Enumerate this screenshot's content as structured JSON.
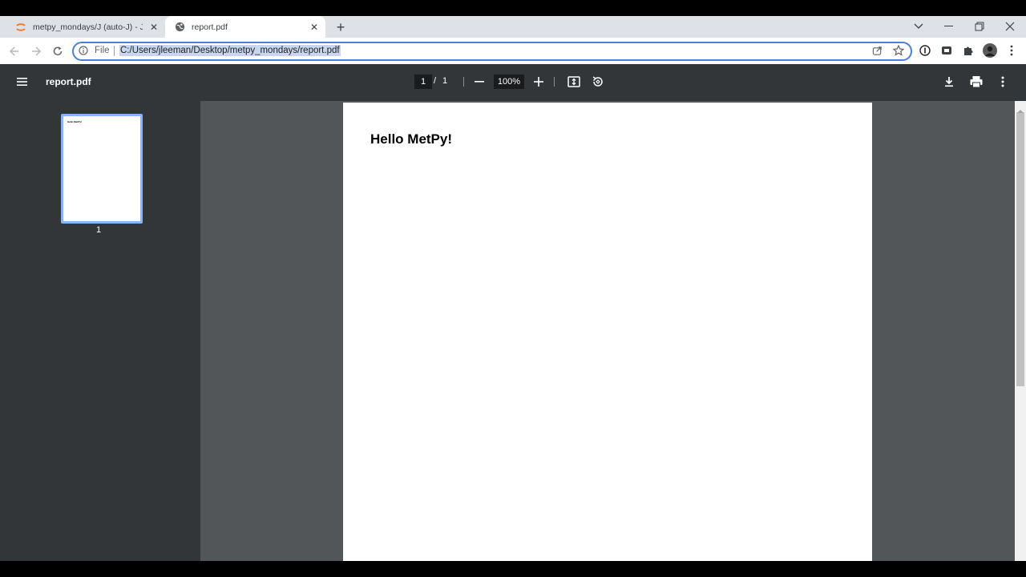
{
  "browser": {
    "tabs": [
      {
        "title": "metpy_mondays/J (auto-J) - Jupy",
        "active": false,
        "favicon": "jupyter-icon"
      },
      {
        "title": "report.pdf",
        "active": true,
        "favicon": "globe-icon"
      }
    ],
    "new_tab_label": "+",
    "address": {
      "scheme_label": "File",
      "url": "C:/Users/jleeman/Desktop/metpy_mondays/report.pdf"
    },
    "colors": {
      "accent": "#4a7fd8",
      "url_selection": "#c8d6ef"
    }
  },
  "pdf_viewer": {
    "title": "report.pdf",
    "current_page": "1",
    "page_separator": "/",
    "total_pages": "1",
    "zoom": "100%",
    "thumbnail_label": "1",
    "thumbnail_text": "Hello MetPy!",
    "document": {
      "heading": "Hello MetPy!"
    },
    "colors": {
      "toolbar": "#323639",
      "viewer_bg": "#525659",
      "thumb_border": "#8ab4f8"
    }
  }
}
